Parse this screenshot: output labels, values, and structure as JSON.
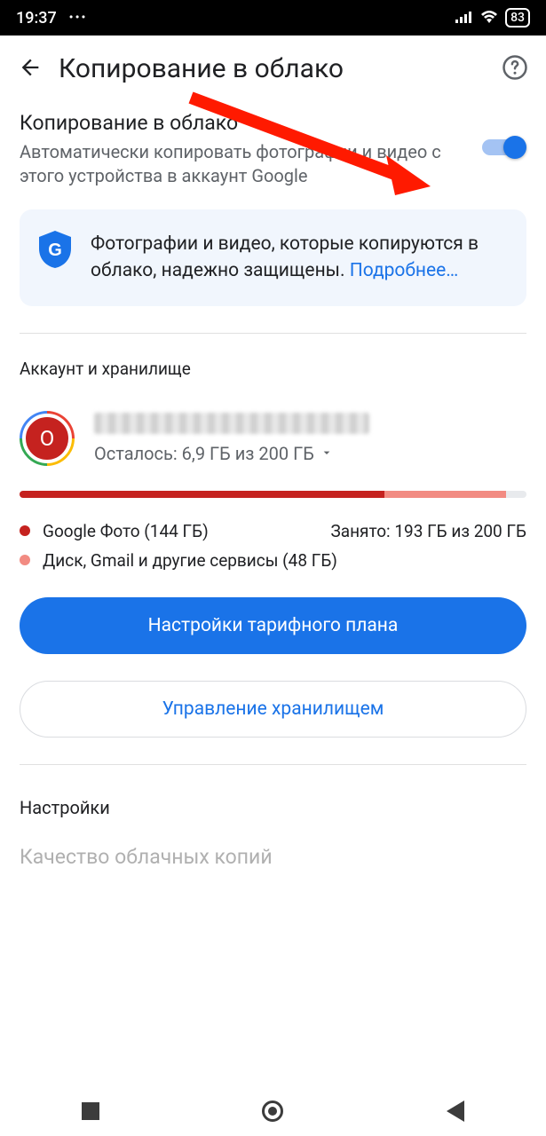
{
  "status": {
    "time": "19:37",
    "battery": "83"
  },
  "header": {
    "title": "Копирование в облако"
  },
  "backup": {
    "title": "Копирование в облако",
    "desc": "Автоматически копировать фотографии и видео с этого устройства в аккаунт Google",
    "toggle_on": true
  },
  "info_card": {
    "text": "Фотографии и видео, которые копируются в облако, надежно защищены. ",
    "link": "Подробнее…"
  },
  "account_section": {
    "label": "Аккаунт и хранилище",
    "avatar_letter": "O",
    "storage_line": "Осталось: 6,9 ГБ из 200 ГБ"
  },
  "storage_bar": {
    "seg1_pct": 72,
    "seg2_pct": 24
  },
  "legend": {
    "row1_dot_color": "#c5221f",
    "row1_text": "Google Фото (144 ГБ)",
    "row1_right": "Занято: 193 ГБ из 200 ГБ",
    "row2_dot_color": "#f28b82",
    "row2_text": "Диск, Gmail и другие сервисы (48 ГБ)"
  },
  "buttons": {
    "primary": "Настройки тарифного плана",
    "secondary": "Управление хранилищем"
  },
  "settings": {
    "label": "Настройки",
    "item1": "Качество облачных копий"
  }
}
